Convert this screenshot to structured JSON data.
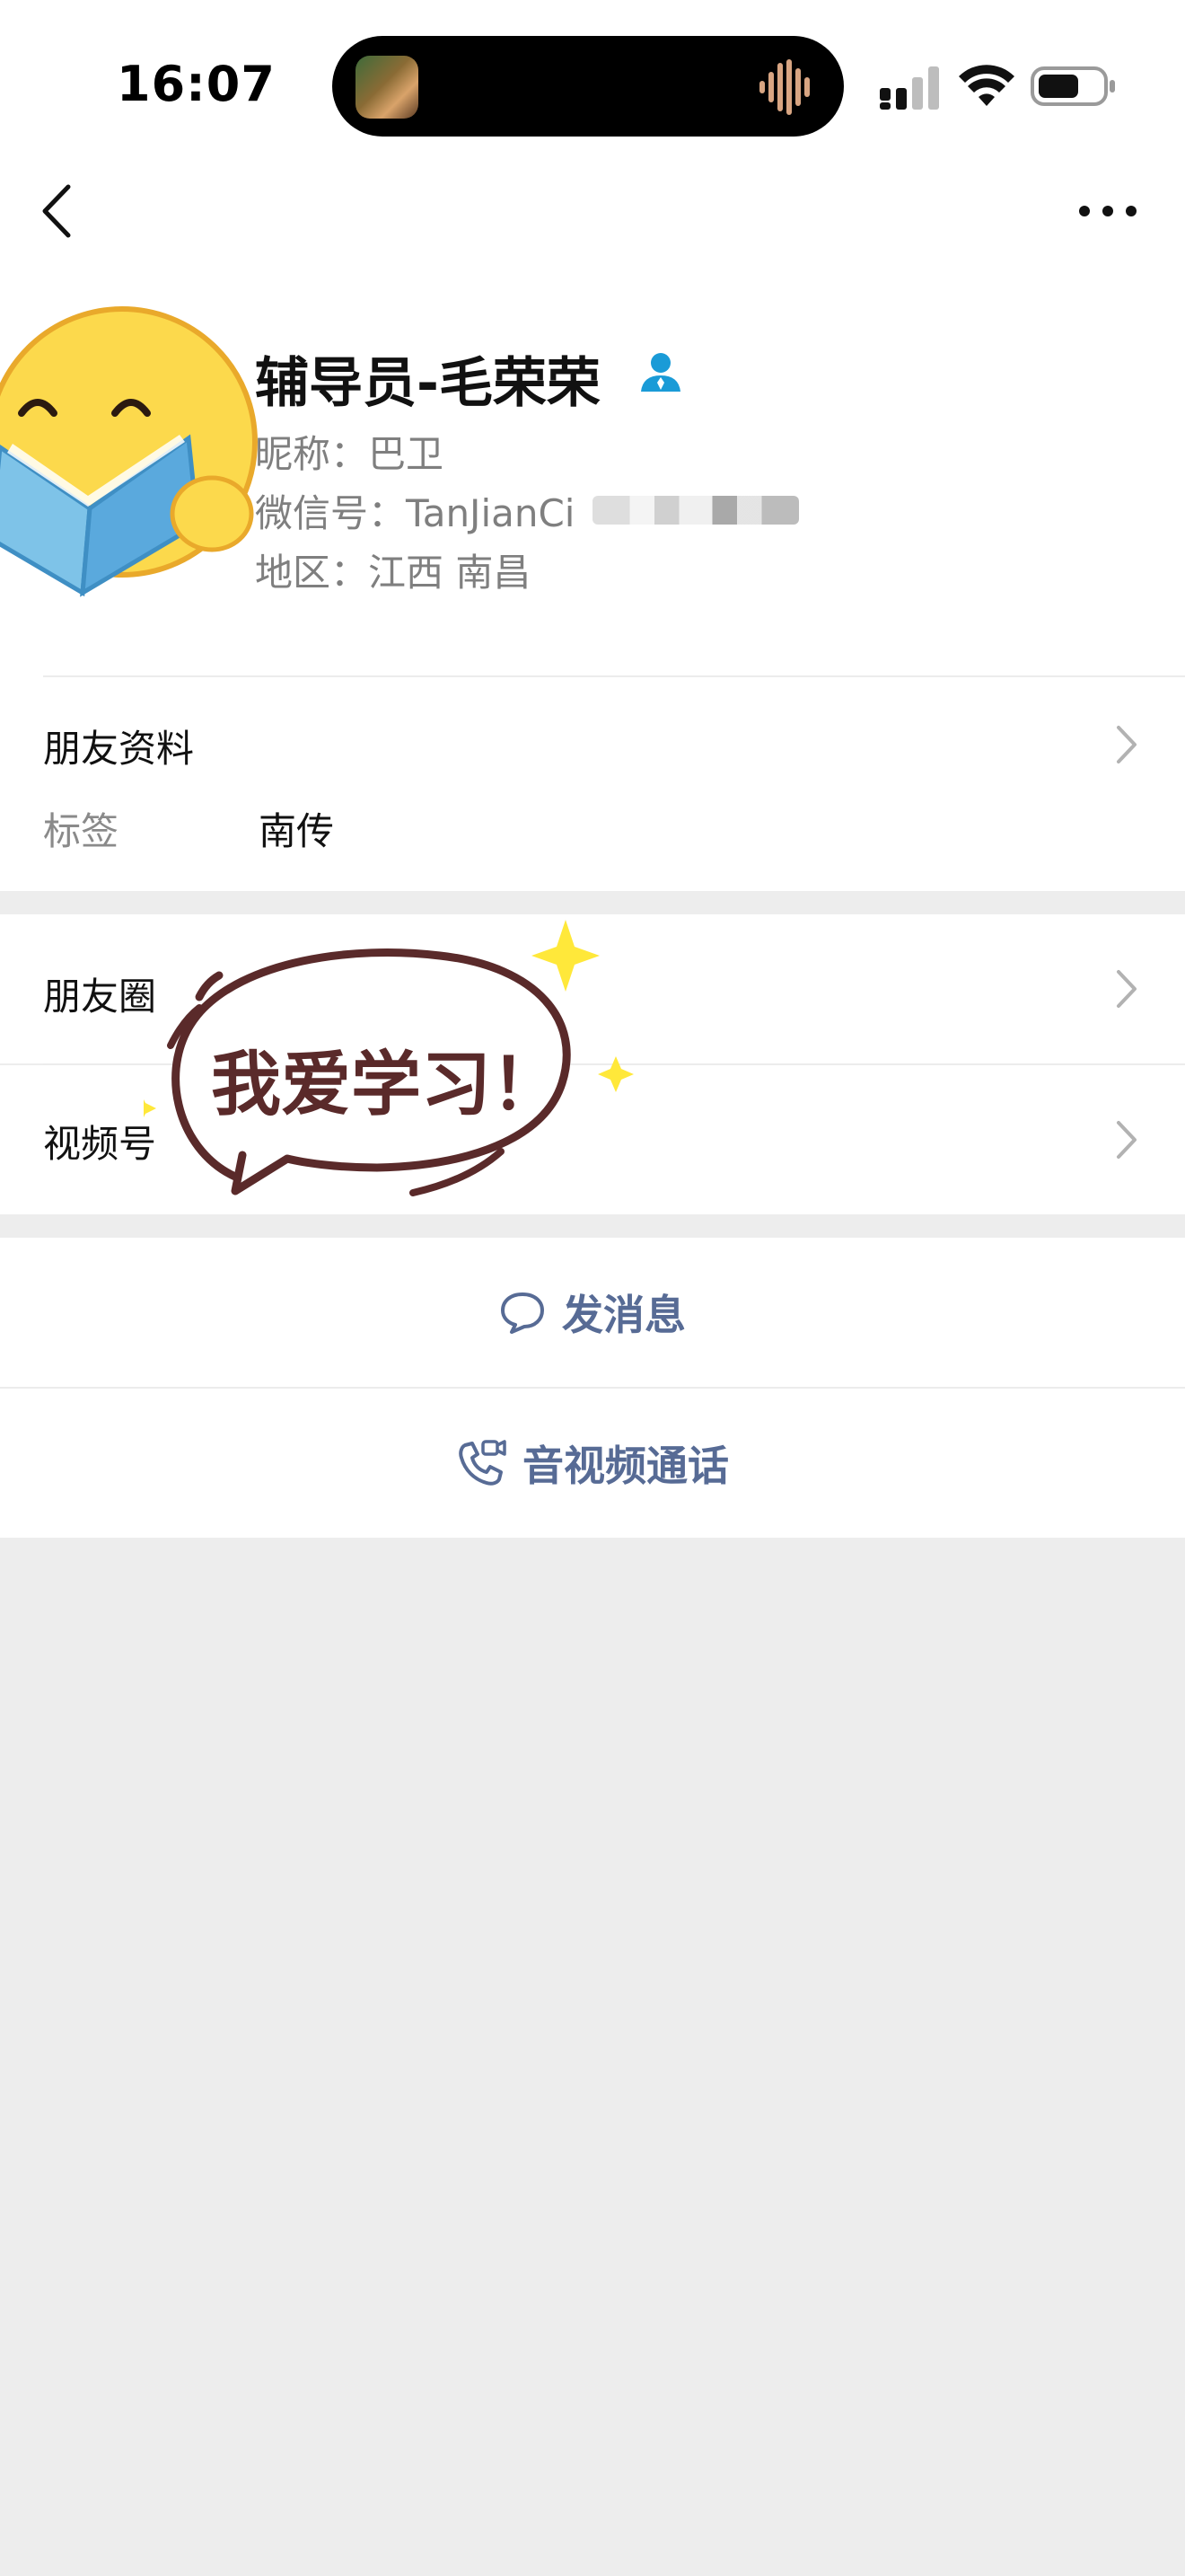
{
  "status_bar": {
    "time": "16:07",
    "icons": [
      "cellular-signal-icon",
      "wifi-icon",
      "battery-icon"
    ]
  },
  "header": {
    "icons": [
      "back-chevron-icon",
      "more-dots-icon"
    ]
  },
  "profile": {
    "name": "辅导员-毛荣荣",
    "nickname": "昵称：巴卫",
    "wechat_id": "微信号：TanJianCi",
    "region": "地区：江西 南昌",
    "icons": [
      "avatar-emoji-reading",
      "person-badge-icon"
    ]
  },
  "friend_info": {
    "label": "朋友资料",
    "tag_label": "标签",
    "tag_value": "南传"
  },
  "moments": {
    "label": "朋友圈"
  },
  "channels": {
    "label": "视频号"
  },
  "actions": {
    "send_message": "发消息",
    "av_call": "音视频通话"
  },
  "sticker": {
    "text": "我爱学习！"
  },
  "colors": {
    "link_blue": "#576b95",
    "badge_blue": "#1a9bd7",
    "page_bg": "#ededed",
    "sticker_yellow": "#ffe83a",
    "sticker_outline": "#5a2a2a"
  }
}
